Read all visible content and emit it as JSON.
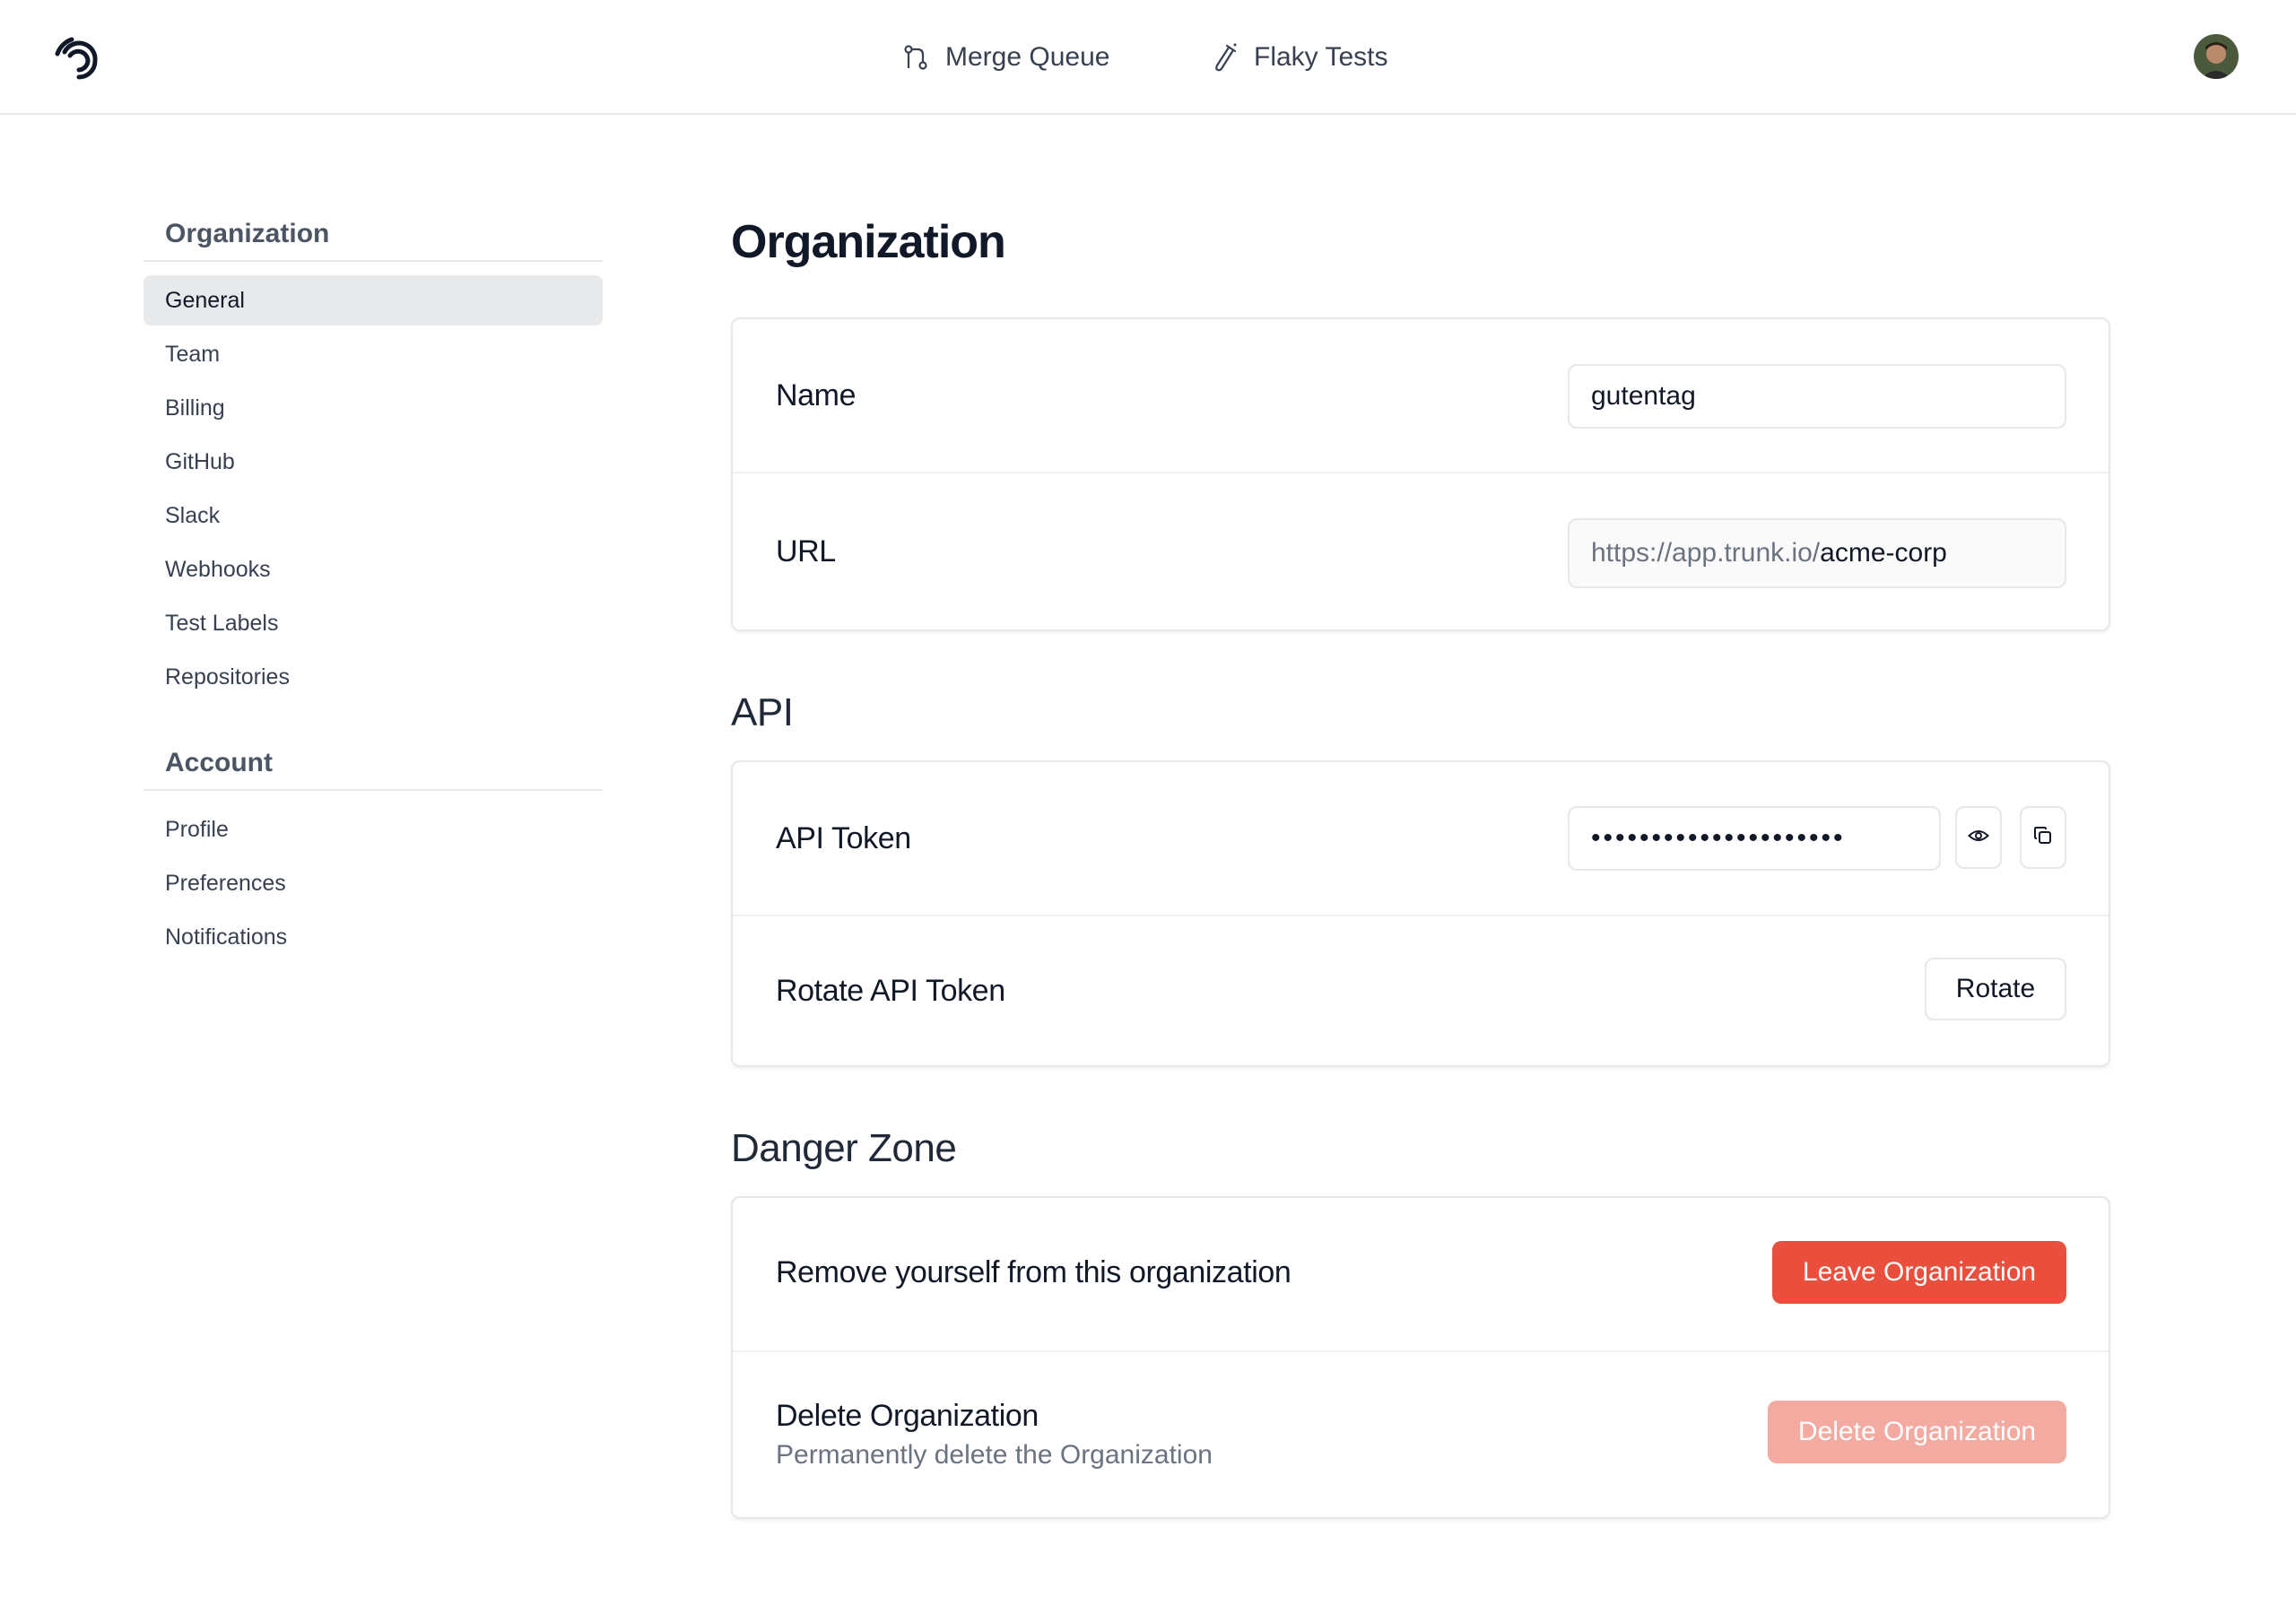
{
  "header": {
    "nav": [
      {
        "label": "Merge Queue",
        "icon": "git-merge-icon"
      },
      {
        "label": "Flaky Tests",
        "icon": "test-tube-icon"
      }
    ]
  },
  "sidebar": {
    "org_heading": "Organization",
    "org_items": [
      {
        "label": "General",
        "active": true
      },
      {
        "label": "Team"
      },
      {
        "label": "Billing"
      },
      {
        "label": "GitHub"
      },
      {
        "label": "Slack"
      },
      {
        "label": "Webhooks"
      },
      {
        "label": "Test Labels"
      },
      {
        "label": "Repositories"
      }
    ],
    "account_heading": "Account",
    "account_items": [
      {
        "label": "Profile"
      },
      {
        "label": "Preferences"
      },
      {
        "label": "Notifications"
      }
    ]
  },
  "main": {
    "title": "Organization",
    "org_card": {
      "name_label": "Name",
      "name_value": "gutentag",
      "url_label": "URL",
      "url_prefix": "https://app.trunk.io/",
      "url_slug": "acme-corp"
    },
    "api_heading": "API",
    "api_card": {
      "token_label": "API Token",
      "token_masked": "•••••••••••••••••••••",
      "rotate_label": "Rotate API Token",
      "rotate_button": "Rotate"
    },
    "danger_heading": "Danger Zone",
    "danger_card": {
      "leave_label": "Remove yourself from this organization",
      "leave_button": "Leave Organization",
      "delete_label": "Delete Organization",
      "delete_sublabel": "Permanently delete the Organization",
      "delete_button": "Delete Organization"
    }
  },
  "colors": {
    "danger": "#e94f3c",
    "danger_disabled": "#f3aaa1",
    "active_bg": "#e8e9eb",
    "border": "#e5e7eb"
  }
}
